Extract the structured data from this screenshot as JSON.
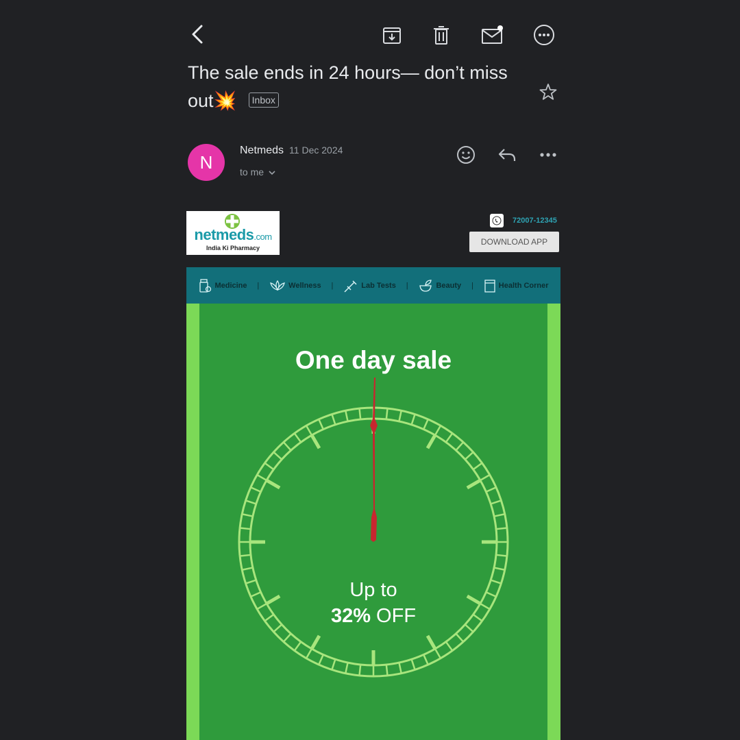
{
  "toolbar": {
    "back_icon": "arrow-left-icon",
    "archive_icon": "archive-icon",
    "delete_icon": "trash-icon",
    "mark_unread_icon": "mail-unread-icon",
    "more_icon": "more-horizontal-icon"
  },
  "email": {
    "subject": "The sale ends in 24 hours— don’t miss out💥",
    "label": "Inbox",
    "sender_initial": "N",
    "sender_name": "Netmeds",
    "date": "11 Dec 2024",
    "recipient": "to me",
    "colors": {
      "avatar": "#e535a8",
      "background": "#202124"
    }
  },
  "message": {
    "logo_text": "netmeds",
    "logo_suffix": ".com",
    "logo_tagline": "India Ki Pharmacy",
    "phone": "72007-12345",
    "download_button": "DOWNLOAD APP",
    "nav": [
      "Medicine",
      "Wellness",
      "Lab Tests",
      "Beauty",
      "Health Corner"
    ],
    "banner_title": "One day sale",
    "offer_line1": "Up to",
    "offer_percent": "32%",
    "offer_off": "OFF",
    "colors": {
      "nav_bg": "#126f7a",
      "banner_bg": "#2f9b3c",
      "accent_green": "#7cd957",
      "hand_red": "#c8262f"
    }
  }
}
